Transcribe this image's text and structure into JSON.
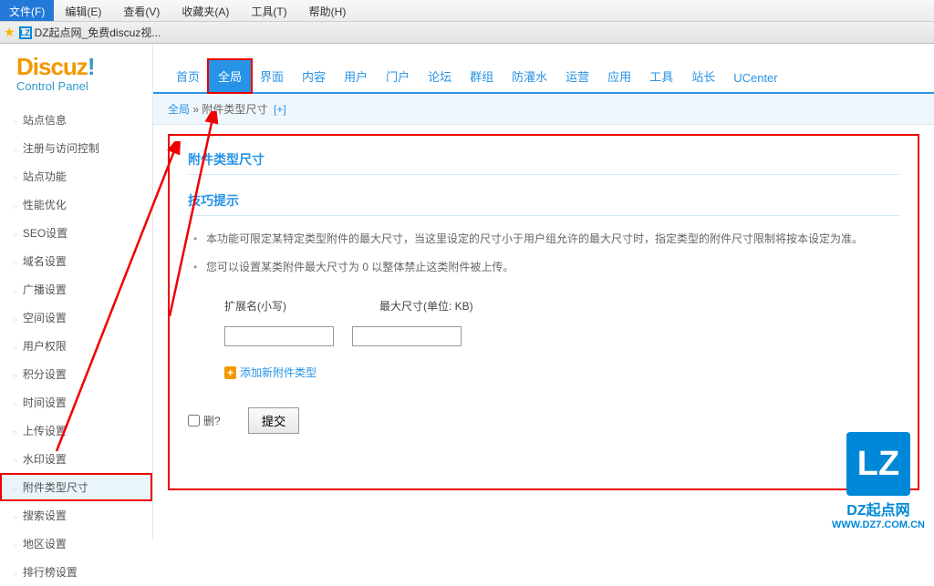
{
  "browser": {
    "menu": [
      "文件(F)",
      "编辑(E)",
      "查看(V)",
      "收藏夹(A)",
      "工具(T)",
      "帮助(H)"
    ],
    "tab_title": "DZ起点网_免费discuz视..."
  },
  "logo": {
    "text": "Discuz",
    "sub": "Control Panel"
  },
  "sidebar": {
    "items": [
      "站点信息",
      "注册与访问控制",
      "站点功能",
      "性能优化",
      "SEO设置",
      "域名设置",
      "广播设置",
      "空间设置",
      "用户权限",
      "积分设置",
      "时间设置",
      "上传设置",
      "水印设置",
      "附件类型尺寸",
      "搜索设置",
      "地区设置",
      "排行榜设置"
    ],
    "active_index": 13,
    "highlighted_index": 13
  },
  "topnav": {
    "items": [
      "首页",
      "全局",
      "界面",
      "内容",
      "用户",
      "门户",
      "论坛",
      "群组",
      "防灌水",
      "运营",
      "应用",
      "工具",
      "站长",
      "UCenter"
    ],
    "active_index": 1,
    "highlighted_index": 1
  },
  "breadcrumb": {
    "root": "全局",
    "sep": " » ",
    "current": "附件类型尺寸",
    "plus": "[+]"
  },
  "content": {
    "title": "附件类型尺寸",
    "tips_title": "技巧提示",
    "tips": [
      "本功能可限定某特定类型附件的最大尺寸，当这里设定的尺寸小于用户组允许的最大尺寸时，指定类型的附件尺寸限制将按本设定为准。",
      "您可以设置某类附件最大尺寸为 0 以整体禁止这类附件被上传。"
    ],
    "col_ext": "扩展名(小写)",
    "col_size": "最大尺寸(单位: KB)",
    "add_label": "添加新附件类型",
    "del_label": "删?",
    "submit_label": "提交"
  },
  "watermark": {
    "logo_text": "LZ",
    "line1": "DZ起点网",
    "line2": "WWW.DZ7.COM.CN"
  }
}
